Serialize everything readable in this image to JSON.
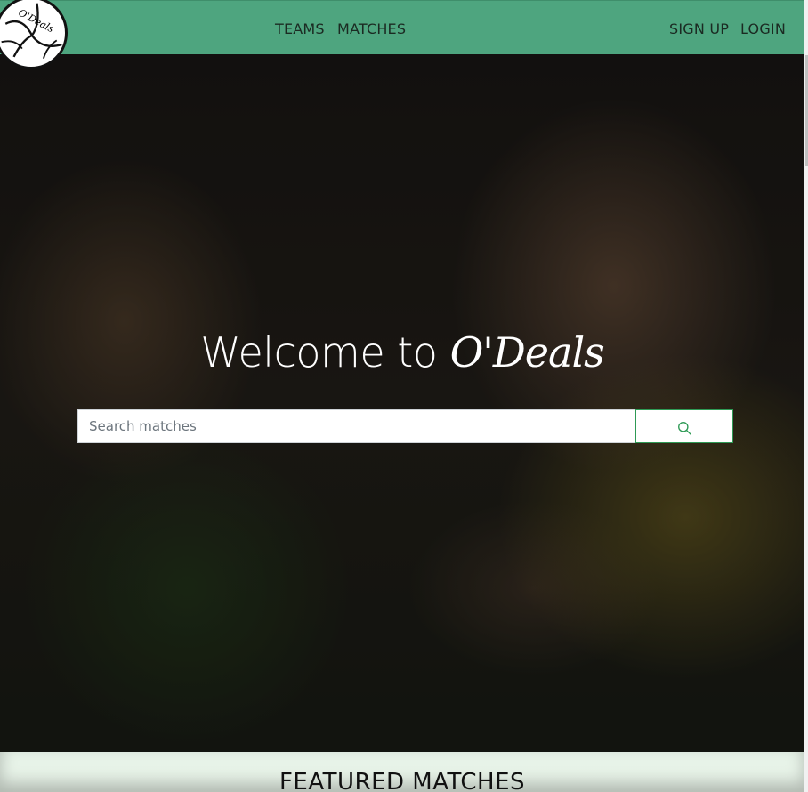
{
  "navbar": {
    "logo_text": "O'Deals",
    "links": {
      "teams": "TEAMS",
      "matches": "MATCHES",
      "signup": "SIGN UP",
      "login": "LOGIN"
    }
  },
  "hero": {
    "title_prefix": "Welcome to",
    "brand": "O'Deals",
    "search": {
      "placeholder": "Search matches",
      "value": "",
      "button_icon": "search-icon"
    }
  },
  "featured": {
    "title": "FEATURED MATCHES"
  },
  "colors": {
    "navbar_bg": "#4ea57f",
    "accent_green": "#2e9a55",
    "featured_bg": "#e6f2e7"
  }
}
